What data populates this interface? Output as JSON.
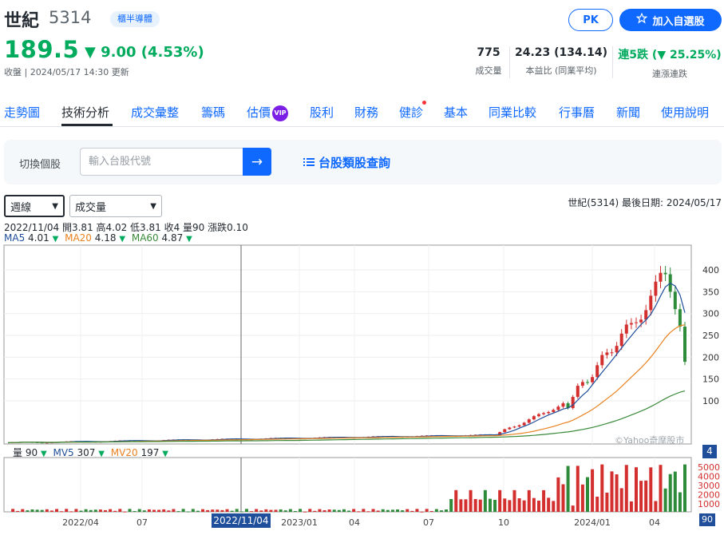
{
  "header": {
    "name": "世紀",
    "code": "5314",
    "badge": "櫃半導體",
    "pk_label": "PK",
    "add_label": "加入自選股",
    "price": "189.5",
    "change": "▼ 9.00 (4.53%)",
    "close_time": "收盤 | 2024/05/17 14:30 更新"
  },
  "stats": [
    {
      "value": "775",
      "label": "成交量"
    },
    {
      "value": "24.23 (134.14)",
      "label": "本益比 (同業平均)"
    },
    {
      "value": "連5跌 (▼ 25.25%)",
      "label": "連漲連跌"
    }
  ],
  "tabs": [
    "走勢圖",
    "技術分析",
    "成交彙整",
    "籌碼",
    "估價",
    "股利",
    "財務",
    "健診",
    "基本",
    "同業比較",
    "行事曆",
    "新聞",
    "使用說明"
  ],
  "vip_label": "VIP",
  "search": {
    "label": "切換個股",
    "placeholder": "輸入台股代號",
    "category_link": "台股類股查詢"
  },
  "controls": {
    "period": "週線",
    "indicator": "成交量",
    "last_date_text": "世紀(5314)    最後日期: 2024/05/17"
  },
  "ohlc_text": "2022/11/04 開3.81 高4.02 低3.81 收4 量90 漲跌0.10",
  "ma": [
    {
      "label": "MA5",
      "value": "4.01",
      "color": "#1f4e9a"
    },
    {
      "label": "MA20",
      "value": "4.18",
      "color": "#e8811f"
    },
    {
      "label": "MA60",
      "value": "4.87",
      "color": "#3a8a3a"
    }
  ],
  "vol_legend": [
    {
      "label": "量",
      "value": "90",
      "color": "#232a31"
    },
    {
      "label": "MV5",
      "value": "307",
      "color": "#1f4e9a"
    },
    {
      "label": "MV20",
      "value": "197",
      "color": "#e8811f"
    }
  ],
  "watermark": "©Yahoo奇摩股市",
  "cursor_date": "2022/11/04",
  "cursor_badge_price": "4",
  "cursor_badge_vol": "90",
  "colors": {
    "up": "#d32f2f",
    "down": "#2e8b3a",
    "accent": "#0f69ff",
    "ma5": "#1f4e9a",
    "ma20": "#e8811f",
    "ma60": "#3a8a3a"
  },
  "chart_data": {
    "type": "candlestick",
    "price_axis": {
      "ticks": [
        100,
        150,
        200,
        250,
        300,
        350,
        400
      ]
    },
    "volume_axis": {
      "ticks": [
        1000,
        2000,
        3000,
        4000,
        5000
      ]
    },
    "x_ticks": [
      "2022/04",
      "07",
      "2022/11/04",
      "2023/01",
      "04",
      "07",
      "10",
      "2024/01",
      "04"
    ],
    "weekly_close_approx": [
      {
        "date": "2023/12",
        "close": 100
      },
      {
        "date": "2024/01",
        "close": 160
      },
      {
        "date": "2024/02",
        "close": 190
      },
      {
        "date": "2024/03",
        "close": 300
      },
      {
        "date": "2024/04",
        "close": 410
      },
      {
        "date": "2024/05",
        "close": 189.5
      }
    ]
  }
}
